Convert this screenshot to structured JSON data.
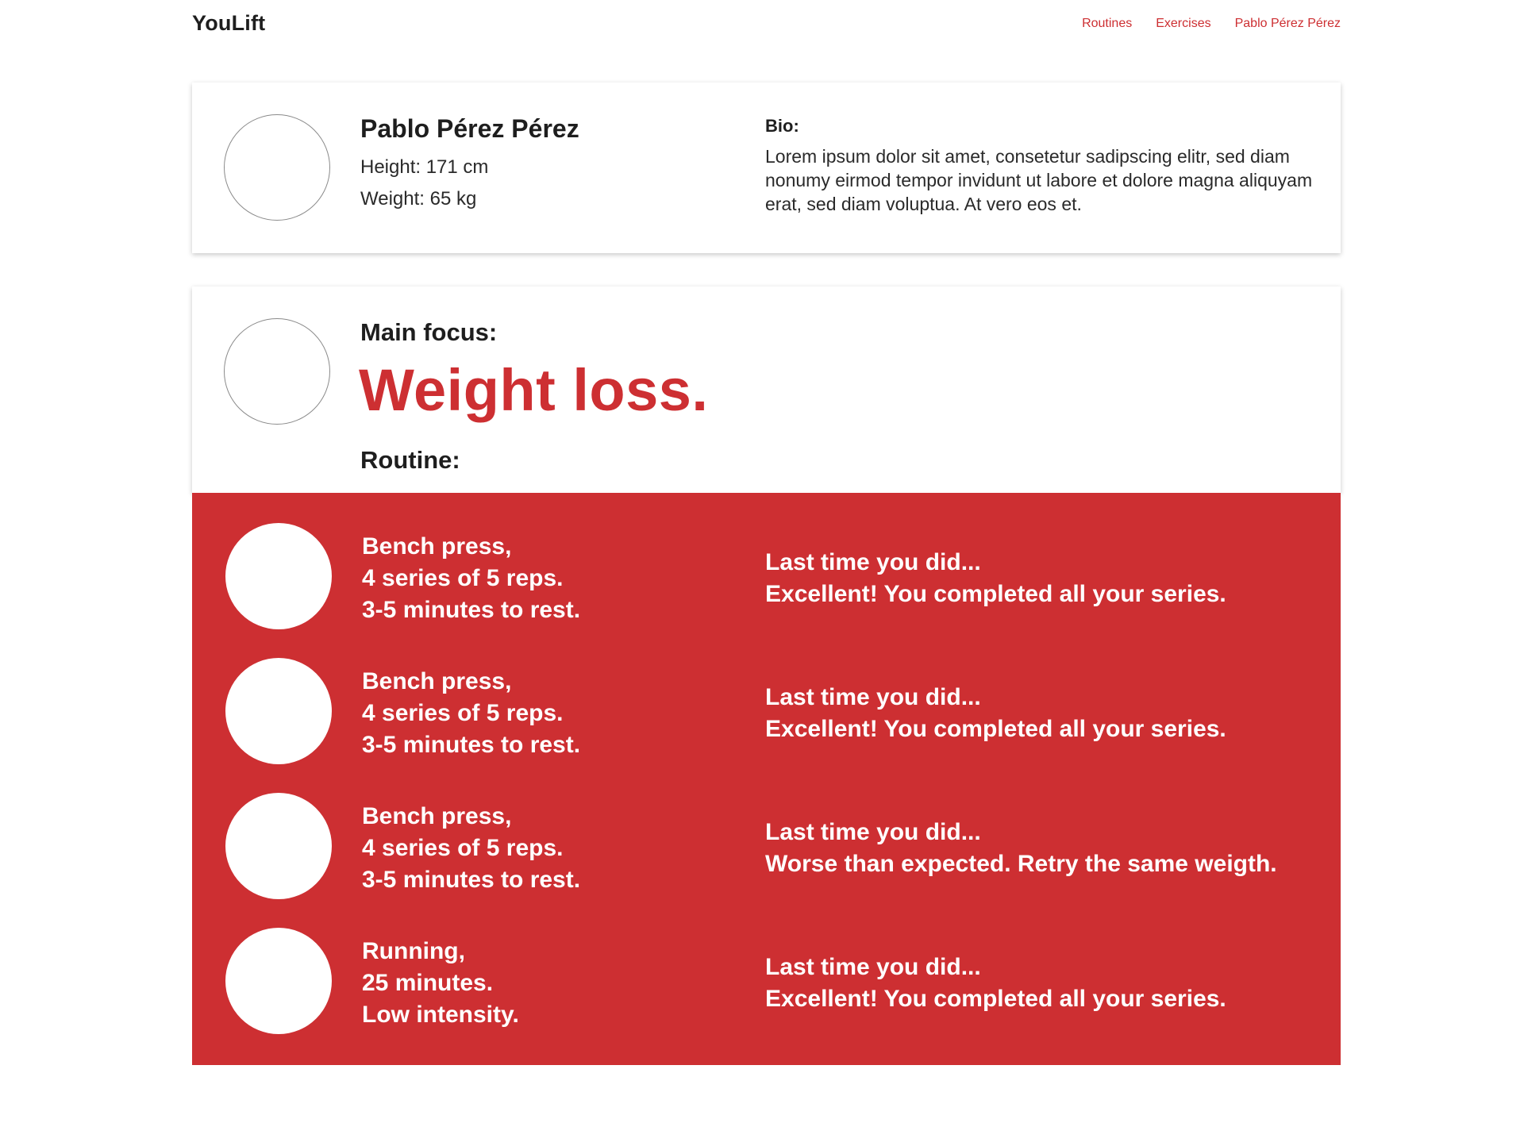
{
  "header": {
    "brand": "YouLift",
    "nav": [
      "Routines",
      "Exercises",
      "Pablo Pérez Pérez"
    ]
  },
  "profile": {
    "name": "Pablo Pérez Pérez",
    "height": "Height: 171 cm",
    "weight": "Weight: 65 kg",
    "bio_label": "Bio:",
    "bio_text": "Lorem ipsum dolor sit amet, consetetur sadipscing elitr, sed diam nonumy eirmod tempor invidunt ut labore et dolore magna aliquyam erat, sed diam voluptua. At vero eos et."
  },
  "focus": {
    "label": "Main focus:",
    "value": "Weight loss.",
    "routine_label": "Routine:"
  },
  "routine": [
    {
      "lines": [
        "Bench press,",
        "4 series of 5 reps.",
        "3-5 minutes to rest."
      ],
      "result_heading": "Last time you did...",
      "result": "Excellent! You completed all your series."
    },
    {
      "lines": [
        "Bench press,",
        "4 series of 5 reps.",
        "3-5 minutes to rest."
      ],
      "result_heading": "Last time you did...",
      "result": "Excellent! You completed all your series."
    },
    {
      "lines": [
        "Bench press,",
        "4 series of 5 reps.",
        "3-5 minutes to rest."
      ],
      "result_heading": "Last time you did...",
      "result": "Worse than expected. Retry the same weigth."
    },
    {
      "lines": [
        "Running,",
        "25 minutes.",
        "Low intensity."
      ],
      "result_heading": "Last time you did...",
      "result": "Excellent! You completed all your series."
    }
  ],
  "colors": {
    "accent": "#cd2f32",
    "text": "#1e1e1e",
    "background": "#ffffff"
  }
}
